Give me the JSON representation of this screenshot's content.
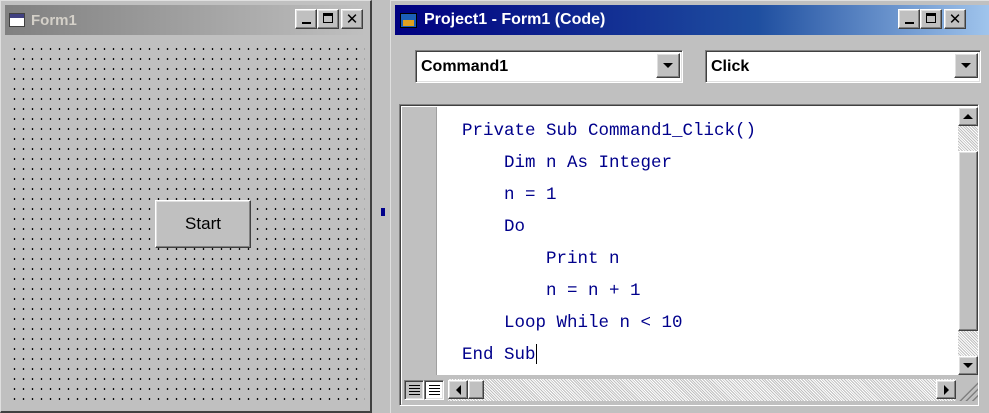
{
  "form_window": {
    "title": "Form1",
    "start_button_label": "Start"
  },
  "code_window": {
    "title": "Project1 - Form1 (Code)",
    "object_combo": "Command1",
    "procedure_combo": "Click",
    "code_lines": [
      "Private Sub Command1_Click()",
      "    Dim n As Integer",
      "    n = 1",
      "    Do",
      "        Print n",
      "        n = n + 1",
      "    Loop While n < 10",
      "End Sub"
    ]
  },
  "icons": {
    "form_title_icon": "form-icon",
    "code_title_icon": "project-code-icon",
    "minimize": "minimize-icon",
    "maximize": "maximize-icon",
    "close": "close-icon",
    "dropdown": "chevron-down-icon"
  },
  "colors": {
    "code_text": "#00008b",
    "active_title_start": "#000080",
    "inactive_title_start": "#808080",
    "window_face": "#c0c0c0"
  }
}
